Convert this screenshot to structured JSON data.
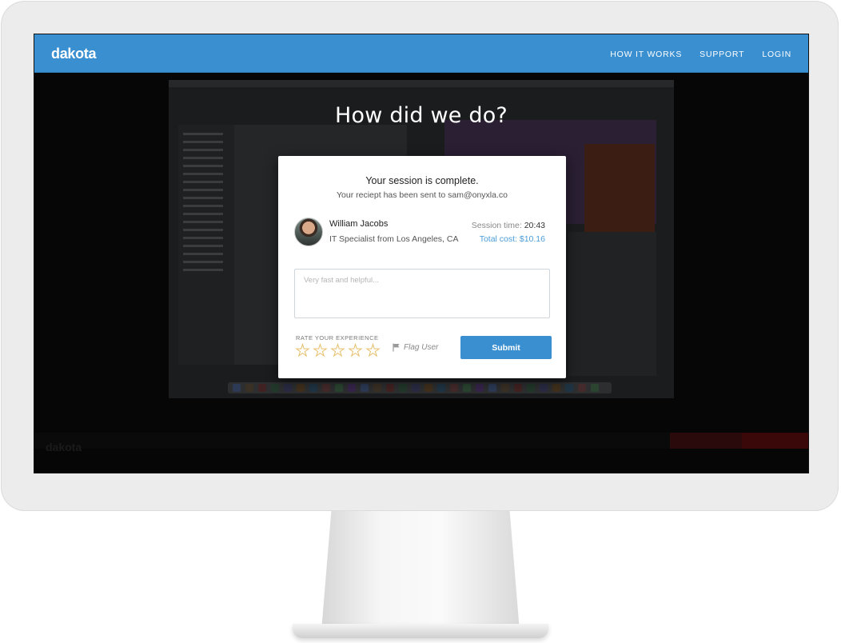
{
  "app": {
    "brand": "dakota",
    "nav": [
      "HOW IT WORKS",
      "SUPPORT",
      "LOGIN"
    ]
  },
  "overlay": {
    "title": "How did we do?"
  },
  "modal": {
    "title": "Your session is complete.",
    "subtitle": "Your reciept has been sent to sam@onyxla.co",
    "expert": {
      "name": "William Jacobs",
      "role": "IT Specialist from Los Angeles, CA"
    },
    "session_time_label": "Session time:",
    "session_time_value": "20:43",
    "total_cost": "Total cost: $10.16",
    "feedback_placeholder": "Very fast and helpful...",
    "rate_label": "RATE YOUR EXPERIENCE",
    "rating": {
      "value": 0,
      "max": 5
    },
    "flag_label": "Flag User",
    "submit_label": "Submit"
  },
  "background": {
    "brand": "dakota"
  },
  "colors": {
    "accent": "#3a8fd0",
    "cost": "#4a9cd8",
    "star_outline": "#e8c170"
  }
}
